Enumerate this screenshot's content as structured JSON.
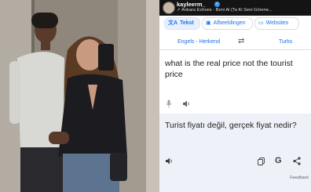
{
  "instagram": {
    "username": "kayleerm_",
    "verified_mark": "✓",
    "music_icon": "music-arrow-icon",
    "music_text": "Ankara Echoes · Beni Al (Ta Ki Seni Görene..."
  },
  "translate": {
    "tabs": [
      {
        "label": "Tekst",
        "icon": "text-translate-icon",
        "active": true
      },
      {
        "label": "Afbeeldingen",
        "icon": "image-icon",
        "active": false
      },
      {
        "label": "Websites",
        "icon": "website-icon",
        "active": false
      }
    ],
    "source_language": "Engels - Herkend",
    "target_language": "Turks",
    "source_text": "what is the real price not the tourist price",
    "translated_text": "Turist fiyatı değil, gerçek fiyat nedir?",
    "feedback_label": "Feedback",
    "accent_color": "#1a73e8",
    "result_background": "#eef1f8"
  }
}
